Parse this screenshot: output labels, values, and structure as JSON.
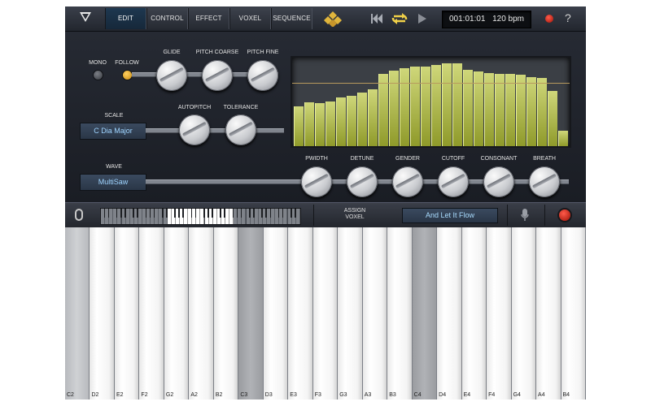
{
  "top_bar": {
    "tabs": [
      {
        "label": "EDIT",
        "active": true
      },
      {
        "label": "CONTROL",
        "active": false
      },
      {
        "label": "EFFECT",
        "active": false
      },
      {
        "label": "VOXEL",
        "active": false
      },
      {
        "label": "SEQUENCE",
        "active": false
      }
    ],
    "position": "001:01:01",
    "tempo": "120 bpm",
    "help": "?",
    "icons": {
      "menu": "triangle-down-icon",
      "rewind": "skip-back-icon",
      "loop": "loop-icon",
      "play": "play-icon",
      "record": "record-icon"
    }
  },
  "edit_panel": {
    "mono_label": "MONO",
    "follow_label": "FOLLOW",
    "mono_on": false,
    "follow_on": true,
    "knobs": {
      "glide": "GLIDE",
      "pitch_coarse": "PITCH COARSE",
      "pitch_fine": "PITCH FINE",
      "autopitch": "AUTOPITCH",
      "tolerance": "TOLERANCE",
      "pwidth": "PWIDTH",
      "detune": "DETUNE",
      "gender": "GENDER",
      "cutoff": "CUTOFF",
      "consonant": "CONSONANT",
      "breath": "BREATH"
    },
    "scale_label": "SCALE",
    "scale_value": "C Dia Major",
    "wave_label": "WAVE",
    "wave_value": "MultiSaw"
  },
  "display": {
    "bar_levels": [
      0.48,
      0.52,
      0.51,
      0.53,
      0.58,
      0.6,
      0.64,
      0.68,
      0.86,
      0.9,
      0.93,
      0.95,
      0.95,
      0.97,
      0.99,
      0.99,
      0.91,
      0.89,
      0.87,
      0.86,
      0.86,
      0.85,
      0.83,
      0.82,
      0.66,
      0.18
    ],
    "threshold": 0.72,
    "bar_color": "#c3cc5c",
    "line_color": "#b89a5e"
  },
  "strip": {
    "assign_line1": "ASSIGN",
    "assign_line2": "VOXEL",
    "song": "And Let It Flow",
    "icons": {
      "clip": "paperclip-icon",
      "mic": "microphone-icon",
      "record": "record-icon"
    }
  },
  "keyboard": {
    "keys": [
      "C2",
      "D2",
      "E2",
      "F2",
      "G2",
      "A2",
      "B2",
      "C3",
      "D3",
      "E3",
      "F3",
      "G3",
      "A3",
      "B3",
      "C4",
      "D4",
      "E4",
      "F4",
      "G4",
      "A4",
      "B4"
    ],
    "highlighted": [
      "C2",
      "C3",
      "C4"
    ]
  }
}
